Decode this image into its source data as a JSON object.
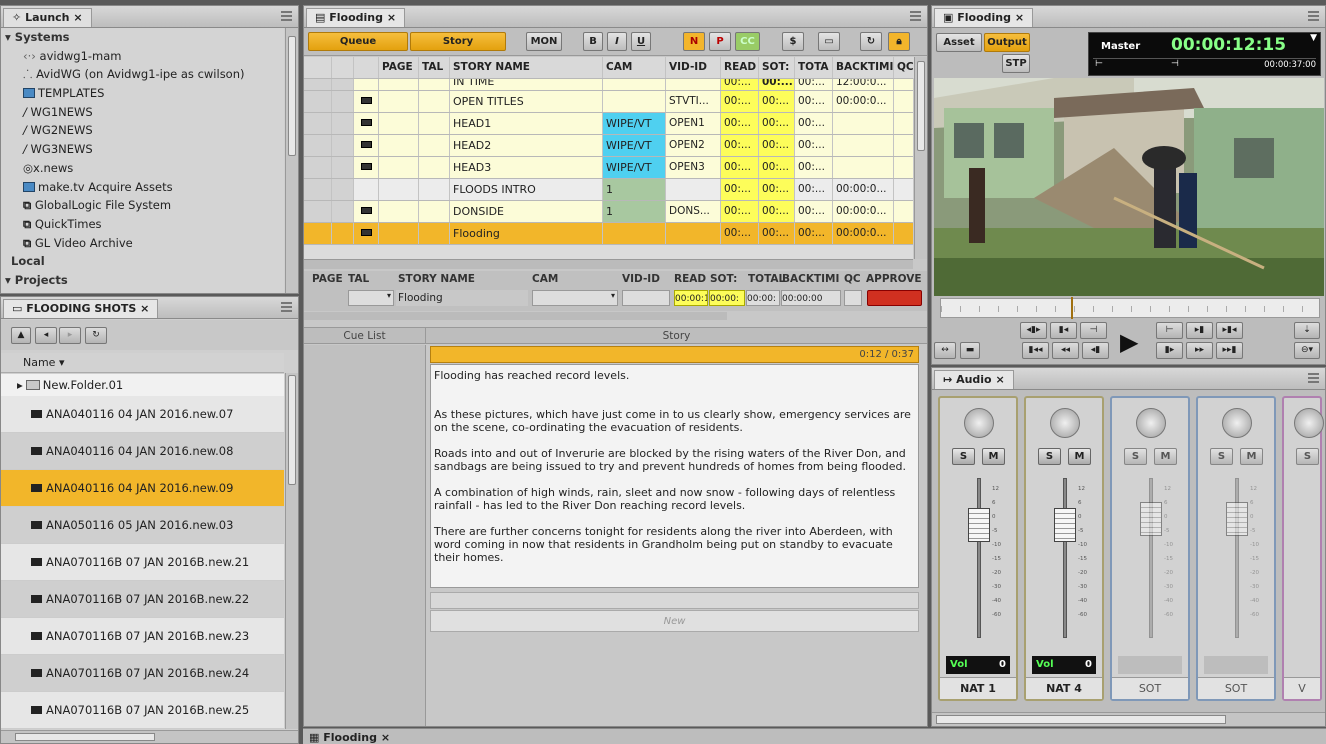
{
  "launch": {
    "tab": "Launch",
    "tree": [
      "Systems",
      "avidwg1-mam",
      "AvidWG (on Avidwg1-ipe as cwilson)",
      "TEMPLATES",
      "WG1NEWS",
      "WG2NEWS",
      "WG3NEWS",
      "x.news",
      "make.tv Acquire Assets",
      "GlobalLogic File System",
      "QuickTimes",
      "GL Video Archive",
      "Local",
      "Projects"
    ]
  },
  "bin": {
    "tab": "FLOODING SHOTS",
    "name_col": "Name",
    "folder": "New.Folder.01",
    "items": [
      "ANA040116 04 JAN 2016.new.07",
      "ANA040116 04 JAN 2016.new.08",
      "ANA040116 04 JAN 2016.new.09",
      "ANA050116 05 JAN 2016.new.03",
      "ANA070116B 07 JAN 2016B.new.21",
      "ANA070116B 07 JAN 2016B.new.22",
      "ANA070116B 07 JAN 2016B.new.23",
      "ANA070116B 07 JAN 2016B.new.24",
      "ANA070116B 07 JAN 2016B.new.25"
    ],
    "selected_index": 2
  },
  "rundown": {
    "tab": "Flooding",
    "toolbar": {
      "queue": "Queue",
      "story": "Story",
      "mon": "MON",
      "b": "B",
      "i": "I",
      "u": "U",
      "n": "N",
      "p": "P",
      "cc": "CC"
    },
    "headers": [
      "PAGE",
      "TAL",
      "STORY NAME",
      "CAM",
      "VID-ID",
      "READ",
      "SOT:",
      "TOTA",
      "BACKTIMI",
      "QC"
    ],
    "rows": [
      {
        "name": "IN TIME",
        "cam": "",
        "vid": "",
        "read": "00:...",
        "sot": "00:...",
        "tota": "00:...",
        "back": "12:00:0..."
      },
      {
        "name": "OPEN TITLES",
        "cam": "",
        "vid": "STVTI...",
        "read": "00:...",
        "sot": "00:...",
        "tota": "00:...",
        "back": "00:00:0..."
      },
      {
        "name": "HEAD1",
        "cam": "WIPE/VT",
        "vid": "OPEN1",
        "read": "00:...",
        "sot": "00:...",
        "tota": "00:...",
        "back": ""
      },
      {
        "name": "HEAD2",
        "cam": "WIPE/VT",
        "vid": "OPEN2",
        "read": "00:...",
        "sot": "00:...",
        "tota": "00:...",
        "back": ""
      },
      {
        "name": "HEAD3",
        "cam": "WIPE/VT",
        "vid": "OPEN3",
        "read": "00:...",
        "sot": "00:...",
        "tota": "00:...",
        "back": ""
      },
      {
        "name": "FLOODS INTRO",
        "cam": "1",
        "vid": "",
        "read": "00:...",
        "sot": "00:...",
        "tota": "00:...",
        "back": "00:00:0..."
      },
      {
        "name": "DONSIDE",
        "cam": "1",
        "vid": "DONS...",
        "read": "00:...",
        "sot": "00:...",
        "tota": "00:...",
        "back": "00:00:0..."
      },
      {
        "name": "Flooding",
        "cam": "",
        "vid": "",
        "read": "00:...",
        "sot": "00:...",
        "tota": "00:...",
        "back": "00:00:0..."
      }
    ],
    "form_headers": [
      "PAGE",
      "TAL",
      "STORY NAME",
      "CAM",
      "VID-ID",
      "READ",
      "SOT:",
      "TOTAL",
      "BACKTIMI",
      "QC",
      "APPROVE"
    ],
    "form_story": "Flooding",
    "form_read": "00:00:1",
    "form_sot": "00:00:",
    "form_total": "00:00:(",
    "form_back": "00:00:00",
    "cue_list": "Cue List",
    "story_label": "Story",
    "timer": "0:12 / 0:37",
    "story_text": [
      "Flooding has reached record levels.",
      "As these pictures, which have just come in to us clearly show, emergency services are on the scene, co-ordinating the evacuation of residents.",
      "Roads into and out of Inverurie are blocked by the rising waters of the River Don, and sandbags are being issued to try and prevent hundreds of homes from being flooded.",
      "A combination of high winds, rain, sleet and now snow - following days of relentless rainfall - has led to the River Don reaching record levels.",
      "There are further concerns tonight for residents along the river into Aberdeen, with word coming in now that residents in Grandholm being put on standby to evacuate their homes."
    ],
    "new_btn": "New",
    "bottom_tab": "Flooding"
  },
  "monitor": {
    "tab": "Flooding",
    "asset": "Asset",
    "output": "Output",
    "stp": "STP",
    "master": "Master",
    "timecode": "00:00:12:15",
    "duration": "00:00:37:00"
  },
  "audio": {
    "tab": "Audio",
    "channels": [
      {
        "name": "NAT 1",
        "vol": "Vol",
        "val": "0",
        "active": true
      },
      {
        "name": "NAT 4",
        "vol": "Vol",
        "val": "0",
        "active": true
      },
      {
        "name": "SOT",
        "vol": "",
        "val": "",
        "active": false
      },
      {
        "name": "SOT",
        "vol": "",
        "val": "",
        "active": false
      },
      {
        "name": "V",
        "vol": "",
        "val": "",
        "active": false
      }
    ],
    "s": "S",
    "m": "M",
    "scale": [
      "12",
      "6",
      "0",
      "-5",
      "-10",
      "-15",
      "-20",
      "-30",
      "-40",
      "-60"
    ]
  },
  "colors": {
    "orange": "#f0b020",
    "yellow": "#fdfd5a",
    "cyan": "#4fd0f0",
    "green": "#a8c8a0",
    "approve_red": "#d03020"
  }
}
